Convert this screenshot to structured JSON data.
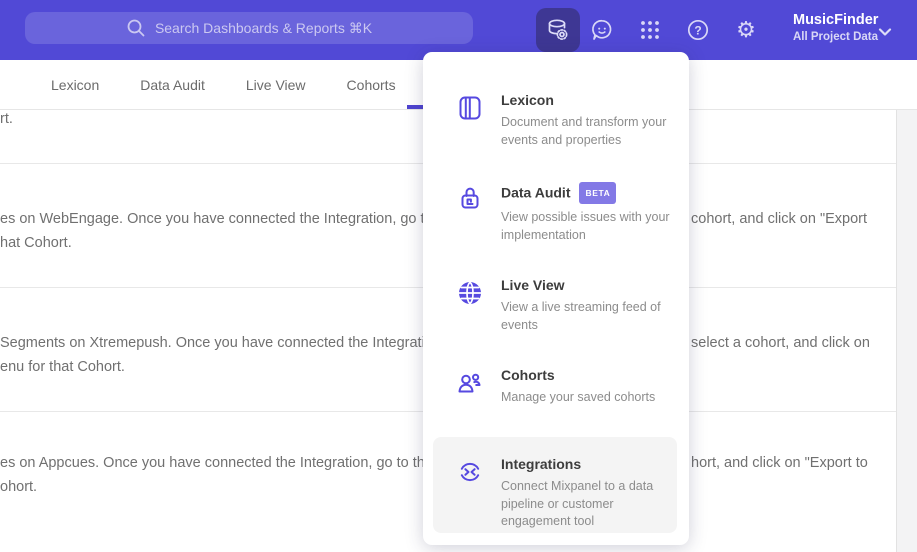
{
  "topbar": {
    "search_placeholder": "Search Dashboards & Reports ⌘K",
    "gear_glyph": "⚙",
    "project_name": "MusicFinder",
    "project_scope": "All Project Data"
  },
  "tabs": {
    "lexicon": "Lexicon",
    "data_audit": "Data Audit",
    "live_view": "Live View",
    "cohorts": "Cohorts"
  },
  "menu": {
    "items": [
      {
        "title": "Lexicon",
        "desc": "Document and transform your events and properties"
      },
      {
        "title": "Data Audit",
        "badge": "BETA",
        "desc": "View possible issues with your implementation"
      },
      {
        "title": "Live View",
        "desc": "View a live streaming feed of events"
      },
      {
        "title": "Cohorts",
        "desc": "Manage your saved cohorts"
      },
      {
        "title": "Integrations",
        "desc": "Connect Mixpanel to a data pipeline or customer engagement tool"
      }
    ]
  },
  "content": {
    "rows": [
      {
        "l1": "rt.",
        "r1": "",
        "l2": ""
      },
      {
        "l1": "es on WebEngage. Once you have connected the Integration, go to the",
        "r1": "cohort, and click on \"Export",
        "l2": "hat Cohort."
      },
      {
        "l1": "Segments on Xtremepush. Once you have connected the Integration,",
        "r1": "select a cohort, and click on",
        "l2": "enu for that Cohort."
      },
      {
        "l1": "es on Appcues. Once you have connected the Integration, go to the M",
        "r1": "hort, and click on \"Export to",
        "l2": "ohort."
      }
    ]
  },
  "colors": {
    "brand": "#5149d6",
    "accent": "#5649e0",
    "badge": "#8379e6",
    "active_btn": "#3e3794"
  }
}
